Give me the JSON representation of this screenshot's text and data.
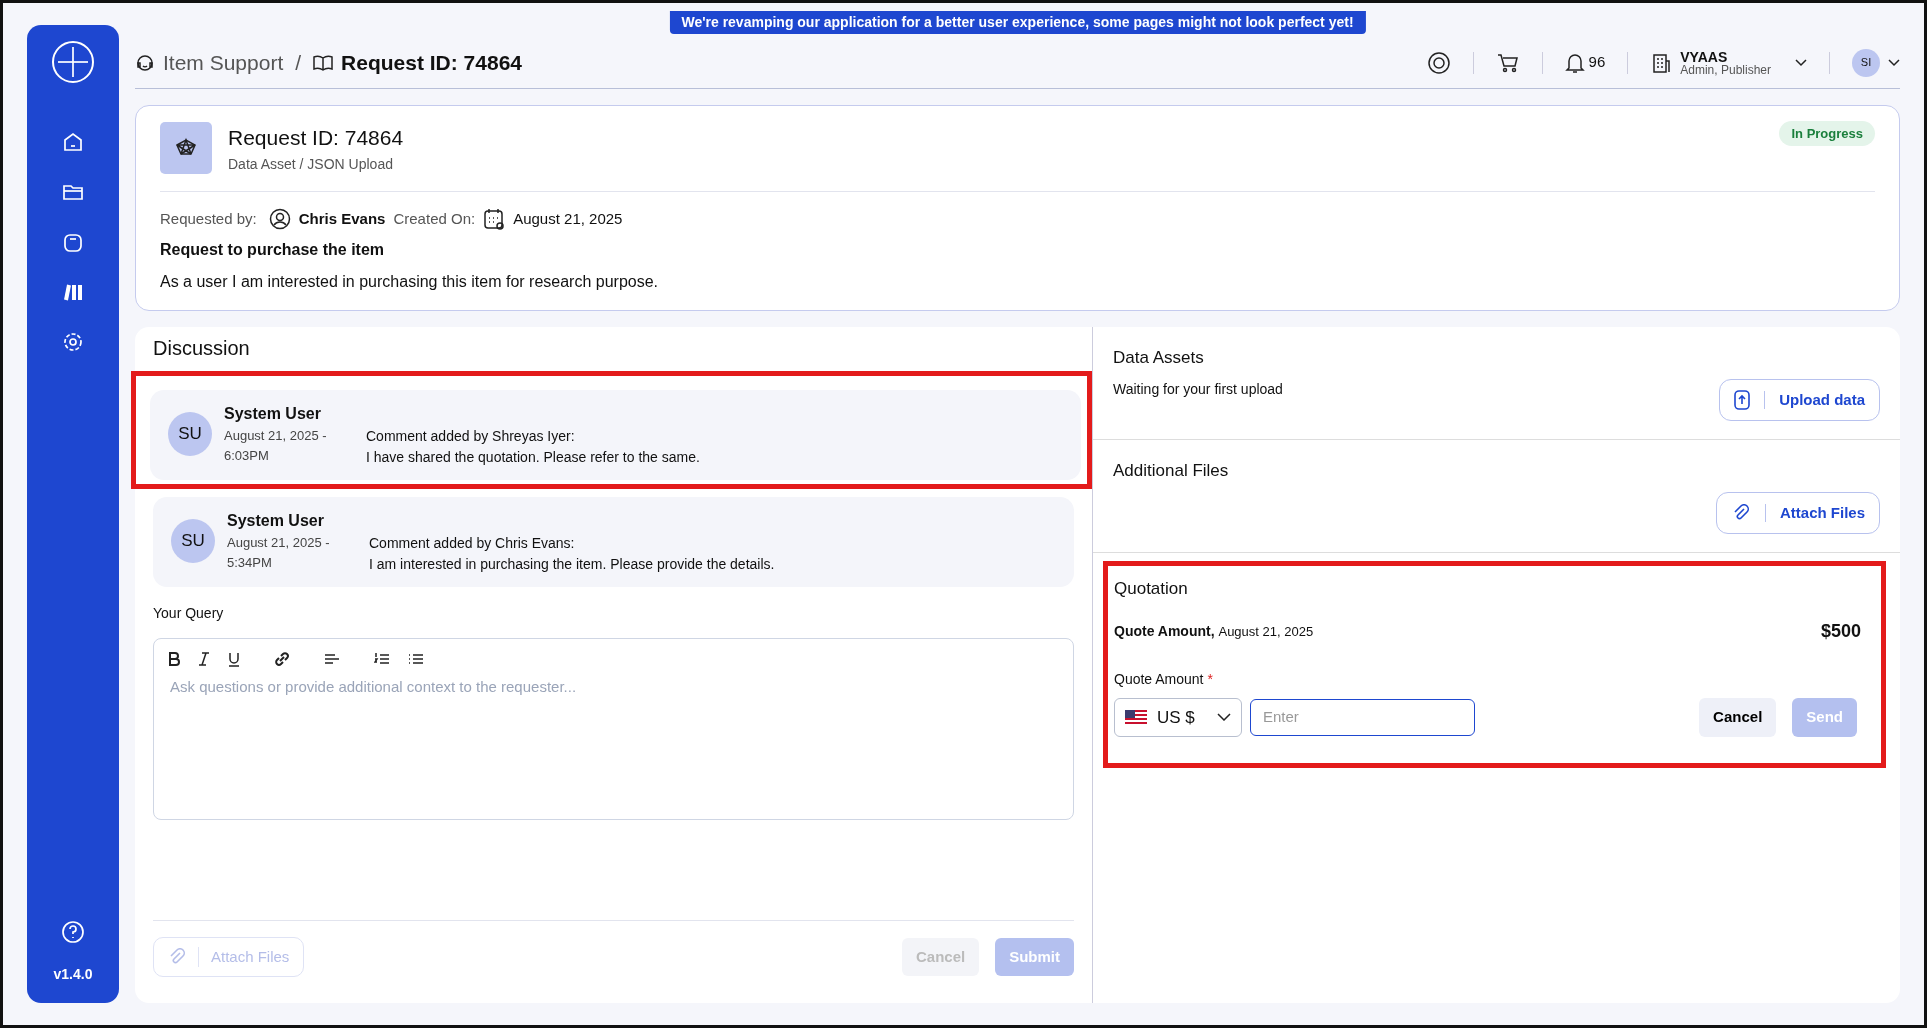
{
  "banner": "We're revamping our application for a better user experience, some pages might not look perfect yet!",
  "sidebar": {
    "version": "v1.4.0"
  },
  "breadcrumb": {
    "separator": "/",
    "items": [
      {
        "label": "Item Support",
        "current": false
      },
      {
        "label": "Request ID: 74864",
        "current": true
      }
    ]
  },
  "header": {
    "notifications": "96",
    "user_name": "VYAAS",
    "user_roles": "Admin, Publisher",
    "initials": "SI"
  },
  "request": {
    "title": "Request ID: 74864",
    "subtitle": "Data Asset / JSON Upload",
    "status": "In Progress",
    "requested_by_label": "Requested by:",
    "requester": "Chris Evans",
    "created_label": "Created On:",
    "created": "August 21, 2025",
    "heading": "Request to purchase the item",
    "description": "As a user I am interested in purchasing this item for research purpose."
  },
  "discussion": {
    "title": "Discussion",
    "comments": [
      {
        "avatar": "SU",
        "author": "System User",
        "time": "August 21, 2025 - 6:03PM",
        "line1": "Comment added by Shreyas Iyer:",
        "line2": "I have shared the quotation. Please refer to the same.",
        "highlighted": true
      },
      {
        "avatar": "SU",
        "author": "System User",
        "time": "August 21, 2025 - 5:34PM",
        "line1": "Comment added by Chris Evans:",
        "line2": "I am interested in purchasing the item. Please provide the details.",
        "highlighted": false
      }
    ],
    "query_label": "Your Query",
    "placeholder": "Ask questions or provide additional context to the requester...",
    "attach": "Attach Files",
    "cancel": "Cancel",
    "submit": "Submit",
    "disabled": true
  },
  "data_assets": {
    "title": "Data Assets",
    "status": "Waiting for your first upload",
    "button": "Upload data"
  },
  "additional_files": {
    "title": "Additional Files",
    "button": "Attach Files"
  },
  "quotation": {
    "title": "Quotation",
    "amount_label": "Quote Amount,",
    "amount_date": "August 21, 2025",
    "amount": "$500",
    "field_label": "Quote Amount",
    "required_mark": "*",
    "currency": "US $",
    "placeholder": "Enter",
    "cancel": "Cancel",
    "send": "Send",
    "send_disabled": true,
    "highlighted": true
  }
}
